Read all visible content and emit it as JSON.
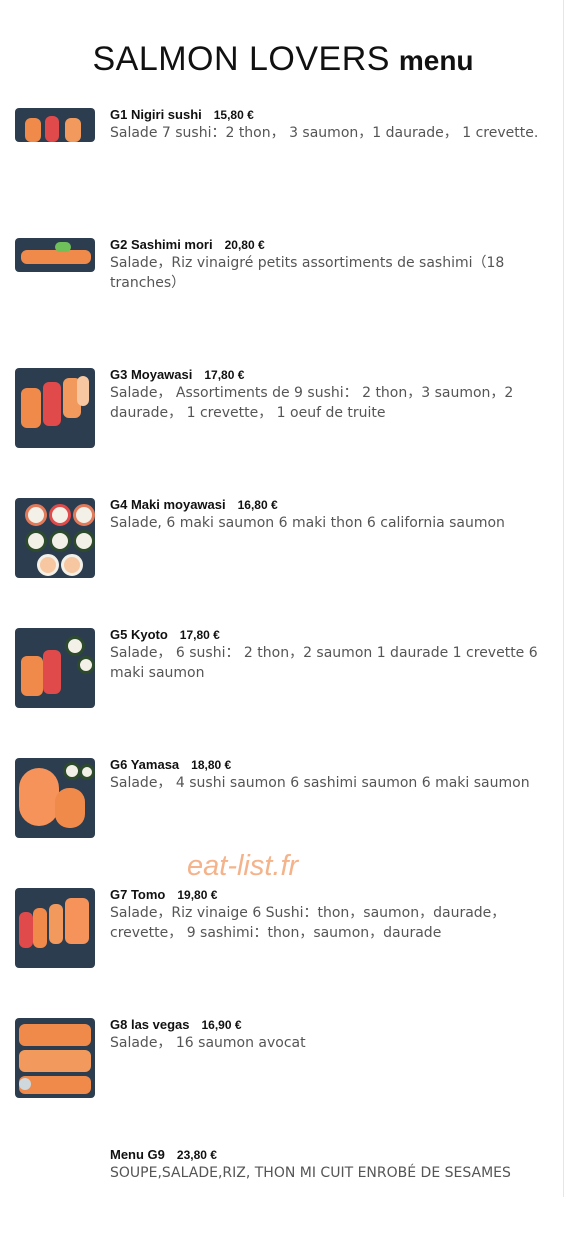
{
  "header": {
    "title_main": "SALMON LOVERS",
    "title_suffix": "menu"
  },
  "watermark": "eat-list.fr",
  "colors": {
    "salmon": "#f08a4b",
    "plate": "#2b3d4f",
    "watermark": "#f4b38a"
  },
  "items": [
    {
      "name": "G1 Nigiri sushi",
      "price": "15,80 €",
      "desc": "Salade 7 sushi：2 thon， 3 saumon，1 daurade， 1 crevette."
    },
    {
      "name": "G2 Sashimi mori",
      "price": "20,80 €",
      "desc": "Salade，Riz vinaigré petits assortiments de sashimi（18 tranches）"
    },
    {
      "name": "G3 Moyawasi",
      "price": "17,80 €",
      "desc": "Salade， Assortiments de 9 sushi： 2 thon，3 saumon，2 daurade， 1 crevette， 1 oeuf de truite"
    },
    {
      "name": "G4 Maki moyawasi",
      "price": "16,80 €",
      "desc": "Salade, 6 maki saumon 6 maki thon 6 california saumon"
    },
    {
      "name": "G5 Kyoto",
      "price": "17,80 €",
      "desc": "Salade， 6 sushi： 2 thon，2 saumon 1 daurade 1 crevette 6 maki saumon"
    },
    {
      "name": "G6 Yamasa",
      "price": "18,80 €",
      "desc": "Salade， 4 sushi saumon 6 sashimi saumon 6 maki saumon"
    },
    {
      "name": "G7 Tomo",
      "price": "19,80 €",
      "desc": "Salade，Riz vinaige 6 Sushi：thon，saumon，daurade， crevette， 9 sashimi：thon，saumon，daurade"
    },
    {
      "name": "G8 las vegas",
      "price": "16,90 €",
      "desc": "Salade， 16 saumon avocat"
    },
    {
      "name": "Menu G9",
      "price": "23,80 €",
      "desc": "SOUPE,SALADE,RIZ, THON MI CUIT ENROBÉ DE SESAMES"
    }
  ]
}
